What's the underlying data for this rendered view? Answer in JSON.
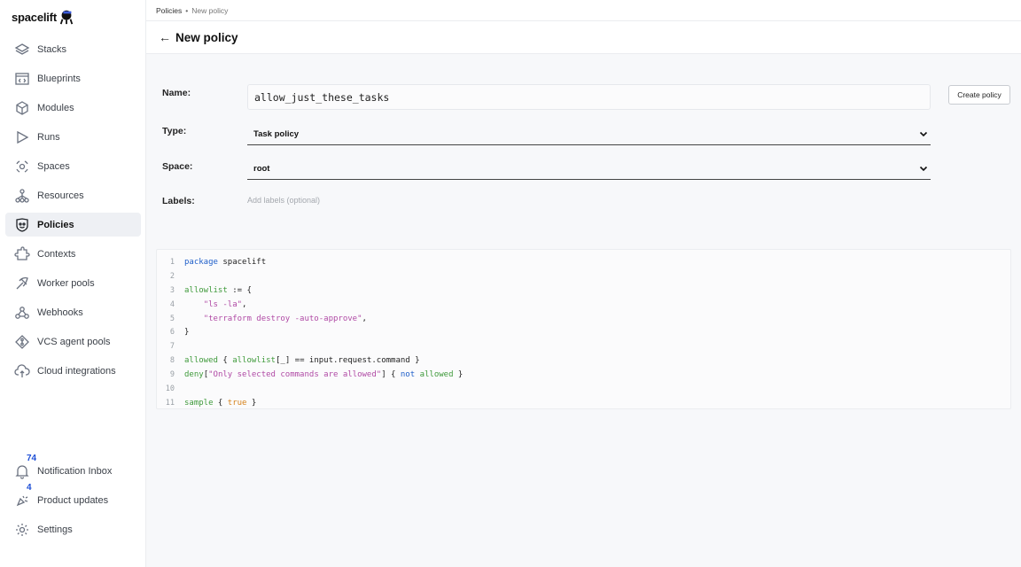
{
  "app": {
    "logo_text": "spacelift"
  },
  "sidebar": {
    "items": [
      {
        "label": "Stacks",
        "icon": "stacks-icon"
      },
      {
        "label": "Blueprints",
        "icon": "blueprints-icon"
      },
      {
        "label": "Modules",
        "icon": "modules-icon"
      },
      {
        "label": "Runs",
        "icon": "runs-icon"
      },
      {
        "label": "Spaces",
        "icon": "spaces-icon"
      },
      {
        "label": "Resources",
        "icon": "resources-icon"
      },
      {
        "label": "Policies",
        "icon": "policies-icon",
        "active": true
      },
      {
        "label": "Contexts",
        "icon": "contexts-icon"
      },
      {
        "label": "Worker pools",
        "icon": "worker-pools-icon"
      },
      {
        "label": "Webhooks",
        "icon": "webhooks-icon"
      },
      {
        "label": "VCS agent pools",
        "icon": "vcs-agent-pools-icon"
      },
      {
        "label": "Cloud integrations",
        "icon": "cloud-integrations-icon"
      }
    ],
    "bottom": {
      "notifications": {
        "label": "Notification Inbox",
        "badge": "74"
      },
      "product_updates": {
        "label": "Product updates",
        "badge": "4"
      },
      "settings": {
        "label": "Settings"
      }
    }
  },
  "breadcrumb": {
    "parent": "Policies",
    "separator": "•",
    "current": "New policy"
  },
  "header": {
    "back": "←",
    "title": "New policy"
  },
  "form": {
    "name_label": "Name:",
    "name_value": "allow_just_these_tasks",
    "type_label": "Type:",
    "type_value": "Task policy",
    "space_label": "Space:",
    "space_value": "root",
    "labels_label": "Labels:",
    "labels_placeholder": "Add labels (optional)",
    "create_button": "Create policy"
  },
  "editor": {
    "lines": [
      {
        "n": "1",
        "tokens": [
          [
            "kw-blue",
            "package"
          ],
          [
            "plain",
            " spacelift"
          ]
        ]
      },
      {
        "n": "2",
        "tokens": []
      },
      {
        "n": "3",
        "tokens": [
          [
            "kw-green",
            "allowlist"
          ],
          [
            "plain",
            " := {"
          ]
        ]
      },
      {
        "n": "4",
        "tokens": [
          [
            "plain",
            "    "
          ],
          [
            "str",
            "\"ls -la\""
          ],
          [
            "plain",
            ","
          ]
        ]
      },
      {
        "n": "5",
        "tokens": [
          [
            "plain",
            "    "
          ],
          [
            "str",
            "\"terraform destroy -auto-approve\""
          ],
          [
            "plain",
            ","
          ]
        ]
      },
      {
        "n": "6",
        "tokens": [
          [
            "plain",
            "}"
          ]
        ]
      },
      {
        "n": "7",
        "tokens": []
      },
      {
        "n": "8",
        "tokens": [
          [
            "kw-green",
            "allowed"
          ],
          [
            "plain",
            " { "
          ],
          [
            "kw-green",
            "allowlist"
          ],
          [
            "plain",
            "[_] == input.request.command }"
          ]
        ]
      },
      {
        "n": "9",
        "tokens": [
          [
            "kw-green",
            "deny"
          ],
          [
            "plain",
            "["
          ],
          [
            "str",
            "\"Only selected commands are allowed\""
          ],
          [
            "plain",
            "] { "
          ],
          [
            "kw-blue",
            "not"
          ],
          [
            "plain",
            " "
          ],
          [
            "kw-green",
            "allowed"
          ],
          [
            "plain",
            " }"
          ]
        ]
      },
      {
        "n": "10",
        "tokens": []
      },
      {
        "n": "11",
        "tokens": [
          [
            "kw-green",
            "sample"
          ],
          [
            "plain",
            " { "
          ],
          [
            "kw-orange",
            "true"
          ],
          [
            "plain",
            " }"
          ]
        ]
      }
    ]
  }
}
